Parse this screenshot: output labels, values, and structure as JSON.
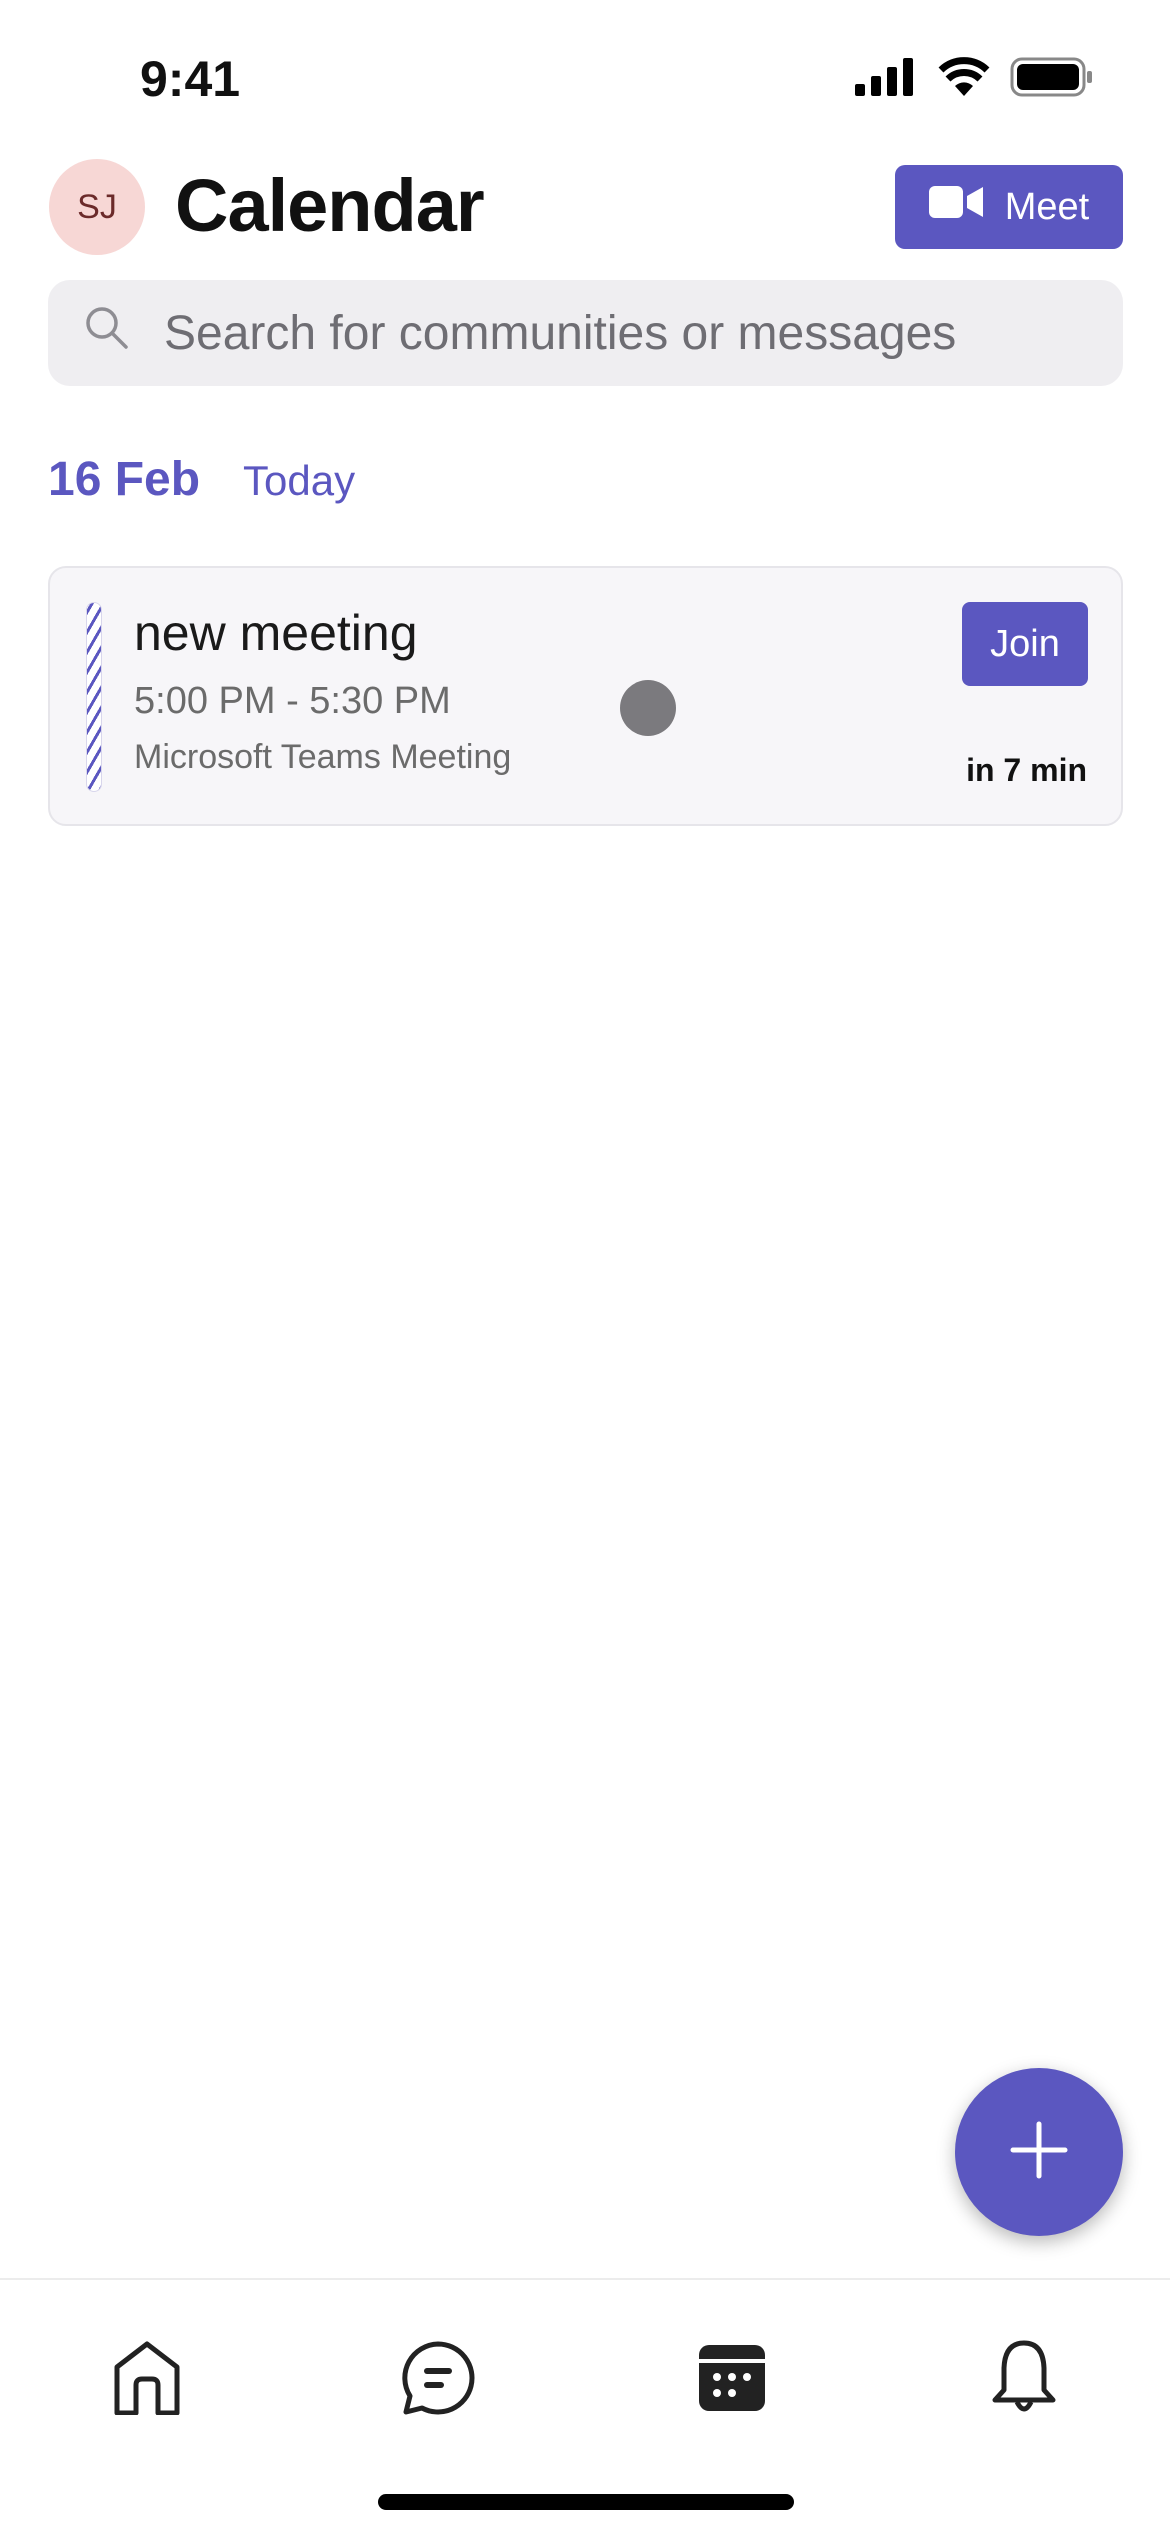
{
  "status_bar": {
    "time": "9:41",
    "icons": [
      "signal-icon",
      "wifi-icon",
      "battery-icon"
    ]
  },
  "header": {
    "avatar_initials": "SJ",
    "title": "Calendar",
    "meet_label": "Meet",
    "meet_icon": "video-camera-icon"
  },
  "search": {
    "placeholder": "Search for communities or messages",
    "icon": "search-icon"
  },
  "date_section": {
    "date": "16 Feb",
    "label": "Today"
  },
  "events": [
    {
      "title": "new meeting",
      "time": "5:00 PM - 5:30 PM",
      "location": "Microsoft Teams Meeting",
      "join_label": "Join",
      "starts_in": "in 7 min"
    }
  ],
  "fab": {
    "icon": "plus-icon"
  },
  "bottom_nav": {
    "items": [
      {
        "icon": "home-icon",
        "active": false
      },
      {
        "icon": "chat-icon",
        "active": false
      },
      {
        "icon": "calendar-icon",
        "active": true
      },
      {
        "icon": "bell-icon",
        "active": false
      }
    ]
  },
  "colors": {
    "accent": "#5b57c0",
    "avatar_bg": "#f7d7d5",
    "card_bg": "#f7f6f9"
  }
}
